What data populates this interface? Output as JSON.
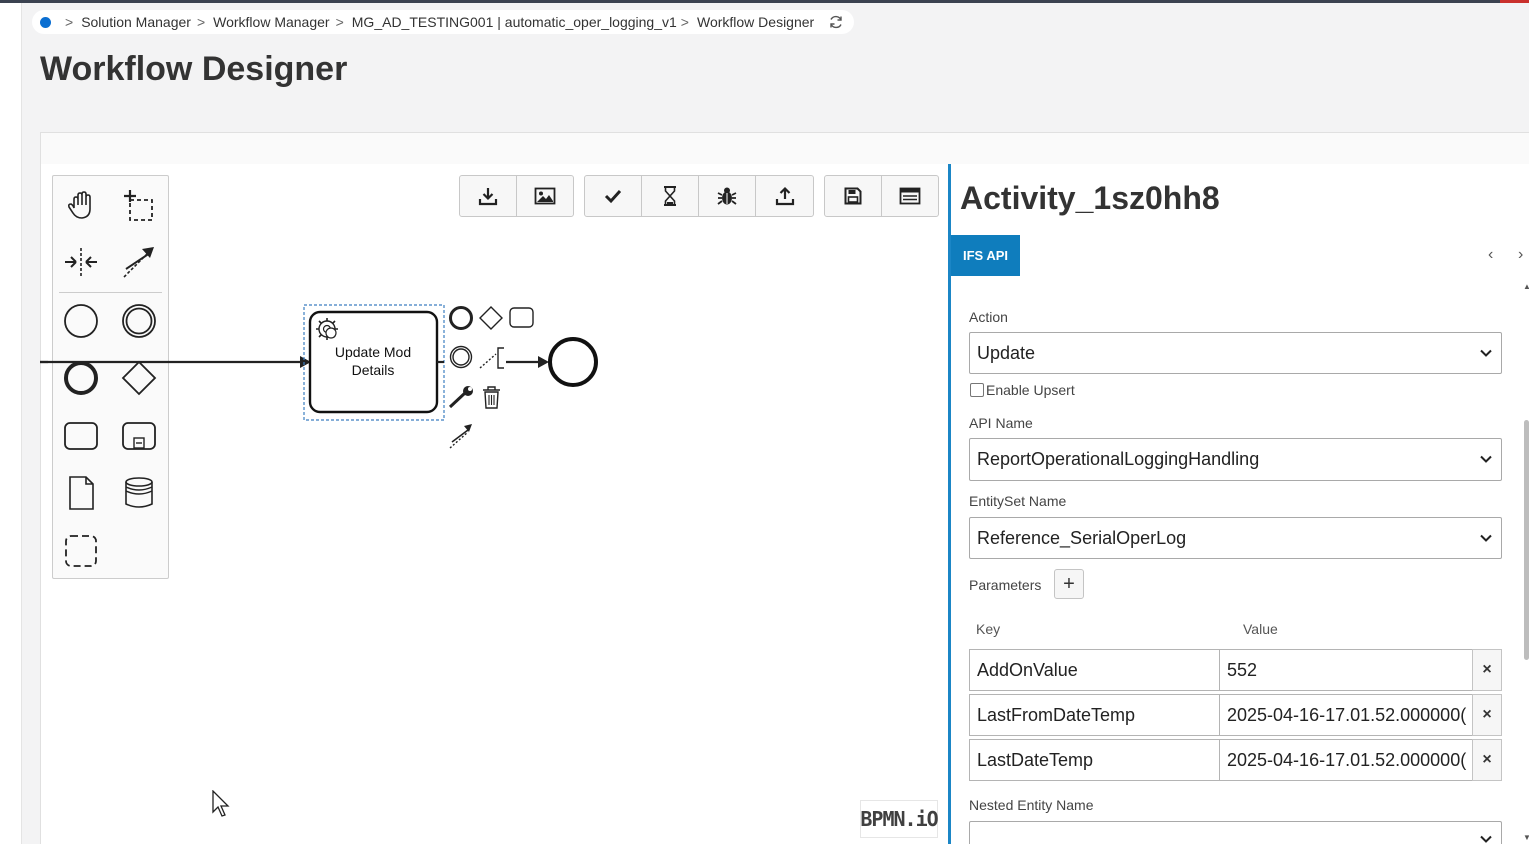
{
  "breadcrumb": {
    "items": [
      "Solution Manager",
      "Workflow Manager",
      "MG_AD_TESTING001 | automatic_oper_logging_v1",
      "Workflow Designer"
    ]
  },
  "page": {
    "title": "Workflow Designer"
  },
  "diagram": {
    "task_label_line1": "Update Mod",
    "task_label_line2": "Details",
    "logo": "BPMN.iO"
  },
  "panel": {
    "title": "Activity_1sz0hh8",
    "tab_label": "IFS API",
    "tab_prev": "‹",
    "tab_next": "›",
    "action_label": "Action",
    "action_value": "Update",
    "upsert_label": "Enable Upsert",
    "api_name_label": "API Name",
    "api_name_value": "ReportOperationalLoggingHandling",
    "entityset_label": "EntitySet Name",
    "entityset_value": "Reference_SerialOperLog",
    "parameters_label": "Parameters",
    "add_symbol": "+",
    "key_header": "Key",
    "value_header": "Value",
    "params": [
      {
        "key": "AddOnValue",
        "value": "552"
      },
      {
        "key": "LastFromDateTemp",
        "value": "2025-04-16-17.01.52.000000("
      },
      {
        "key": "LastDateTemp",
        "value": "2025-04-16-17.01.52.000000("
      }
    ],
    "delete_symbol": "×",
    "nested_label": "Nested Entity Name"
  },
  "colors": {
    "accent": "#0f7dbd",
    "panel_border": "#1b86c6",
    "breadcrumb_dot": "#0a6ed1"
  }
}
